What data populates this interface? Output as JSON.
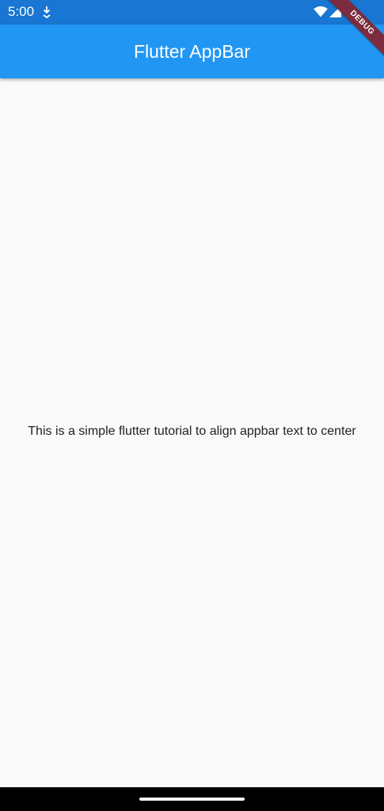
{
  "status_bar": {
    "time": "5:00",
    "icons": [
      "download-icon",
      "wifi-icon",
      "cell-signal-icon"
    ]
  },
  "app_bar": {
    "title": "Flutter AppBar"
  },
  "debug_banner": {
    "label": "DEBUG"
  },
  "body": {
    "text": "This is a simple flutter tutorial to align appbar text to center"
  },
  "colors": {
    "status_bar": "#1976d2",
    "app_bar": "#2196f3",
    "background": "#fafafa",
    "debug_banner": "#7b2c3e",
    "nav_bar": "#000000"
  }
}
